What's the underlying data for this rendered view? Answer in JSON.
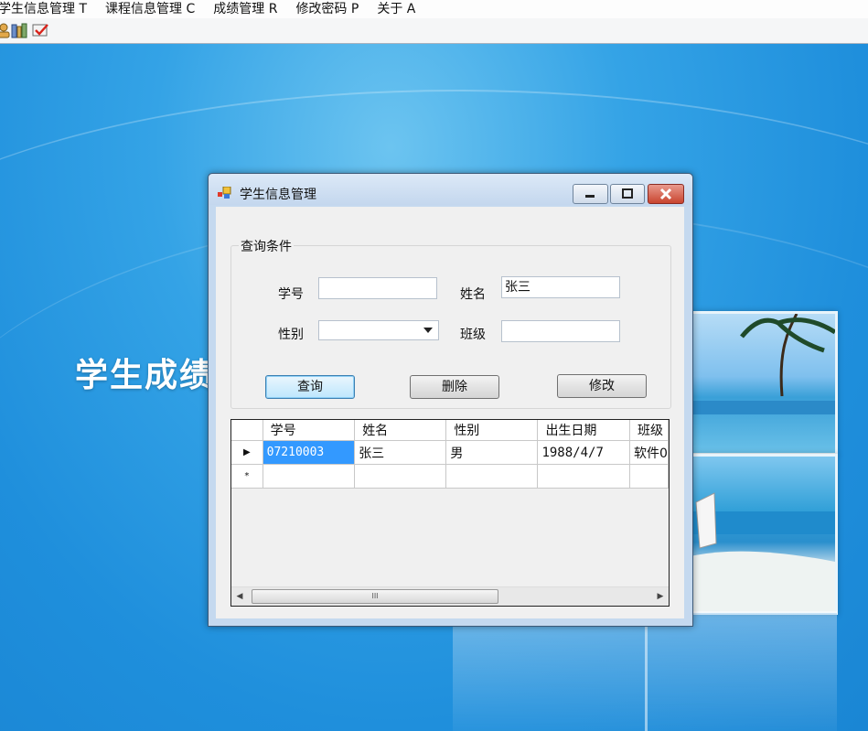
{
  "menubar": {
    "items": [
      "学生信息管理 T",
      "课程信息管理 C",
      "成绩管理 R",
      "修改密码 P",
      "关于 A"
    ]
  },
  "toolbar": {
    "buttons": [
      "user-icon",
      "books-icon",
      "checklist-icon"
    ]
  },
  "desktop": {
    "banner_text": "学生成绩"
  },
  "dialog": {
    "title": "学生信息管理",
    "query_group": {
      "legend": "查询条件",
      "student_id_label": "学号",
      "student_id_value": "",
      "name_label": "姓名",
      "name_value": "张三",
      "gender_label": "性别",
      "gender_value": "",
      "class_label": "班级",
      "class_value": ""
    },
    "buttons": {
      "query": "查询",
      "delete": "删除",
      "modify": "修改"
    },
    "grid": {
      "columns": [
        "学号",
        "姓名",
        "性别",
        "出生日期",
        "班级"
      ],
      "rows": [
        [
          "07210003",
          "张三",
          "男",
          "1988/4/7",
          "软件0"
        ]
      ],
      "row_markers": [
        "▶",
        "*"
      ],
      "scroll_grip": "III",
      "scroll_left_arrow": "◀",
      "scroll_right_arrow": "▶"
    }
  },
  "colors": {
    "selection": "#3399ff",
    "desktop_blue": "#34a3e6"
  }
}
